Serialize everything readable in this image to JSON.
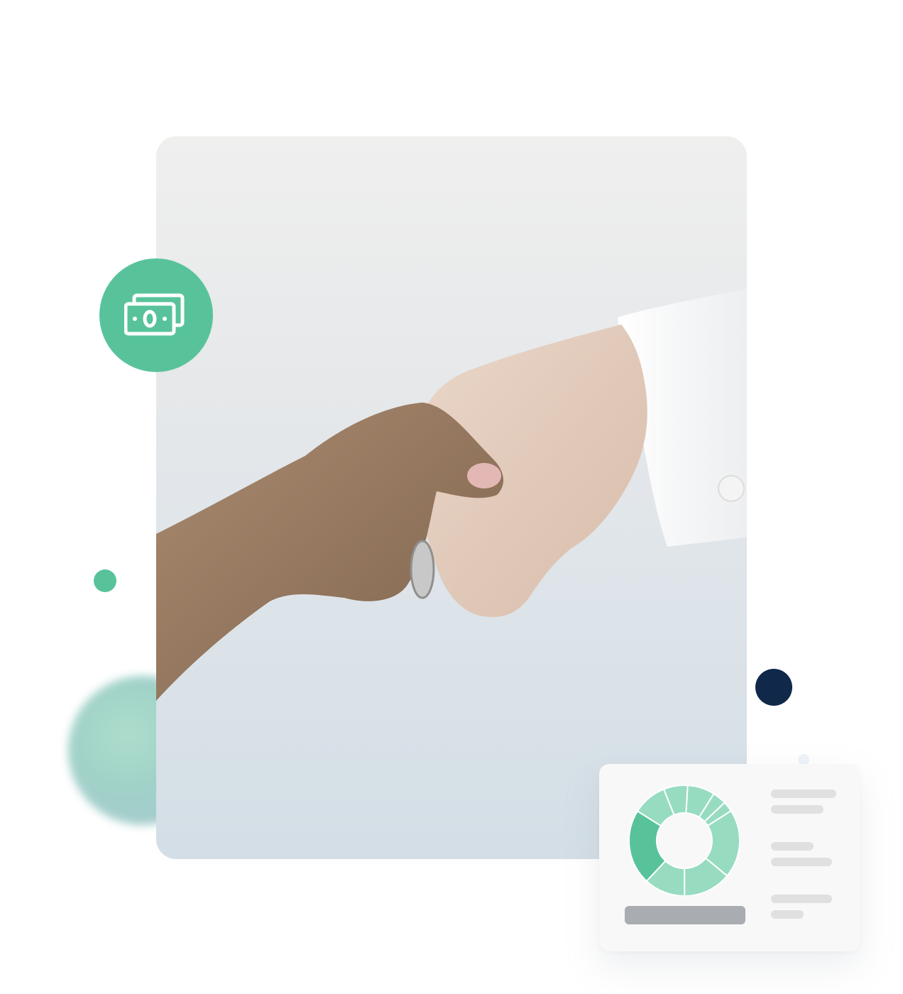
{
  "colors": {
    "accent_green": "#58c39a",
    "light_green": "#97dcc0",
    "navy": "#10284a",
    "placeholder_gray": "#e0e0e0",
    "bar_gray": "#a9adb1"
  },
  "badge": {
    "icon": "money-bills-icon"
  },
  "photo": {
    "subject": "handshake-photo"
  },
  "widget": {
    "donut_segments": [
      8,
      4,
      3,
      20,
      14,
      12,
      22,
      10,
      7
    ],
    "highlighted_segment_index": 6
  }
}
